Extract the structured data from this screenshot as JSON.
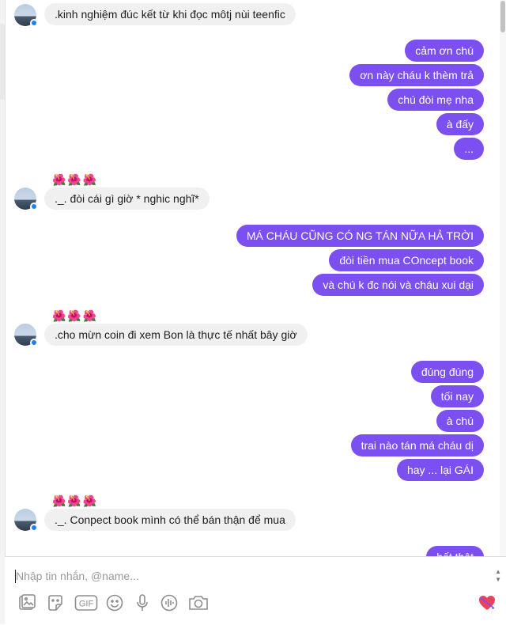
{
  "composer": {
    "placeholder": "Nhập tin nhắn, @name..."
  },
  "flower_reaction": "🌺🌺🌺",
  "messages": [
    {
      "text": ".kinh nghiệm đúc kết từ khi đọc môtj nùi teenfic"
    },
    {
      "text": "cảm ơn chú"
    },
    {
      "text": "ơn này cháu k thèm trả"
    },
    {
      "text": "chú đòi mẹ nha"
    },
    {
      "text": "à đấy"
    },
    {
      "text": "..."
    },
    {
      "text": "._. đòi cái gì giờ * nghic nghĩ*"
    },
    {
      "text": "MÁ CHÁU CŨNG CÓ NG TÁN NỮA HẢ TRỜI"
    },
    {
      "text": "đòi tiền mua COncept book"
    },
    {
      "text": "và chú k đc nói và cháu xui dại"
    },
    {
      "text": ".cho mừn coin đi xem Bon là thực tế nhất bây giờ"
    },
    {
      "text": "đúng đúng"
    },
    {
      "text": "tối nay"
    },
    {
      "text": "à chú"
    },
    {
      "text": "trai nào tán má cháu dị"
    },
    {
      "text": "hay ... lại GÁI"
    },
    {
      "text": "._. Conpect book mình có thể bán thận để mua"
    },
    {
      "text": "hết thật"
    }
  ],
  "toolbar": {
    "icons": [
      "image-icon",
      "sticker-icon",
      "gif-icon",
      "emoji-icon",
      "microphone-icon",
      "voice-clip-icon",
      "camera-icon",
      "heart-icon"
    ],
    "gif_label": "GIF"
  }
}
